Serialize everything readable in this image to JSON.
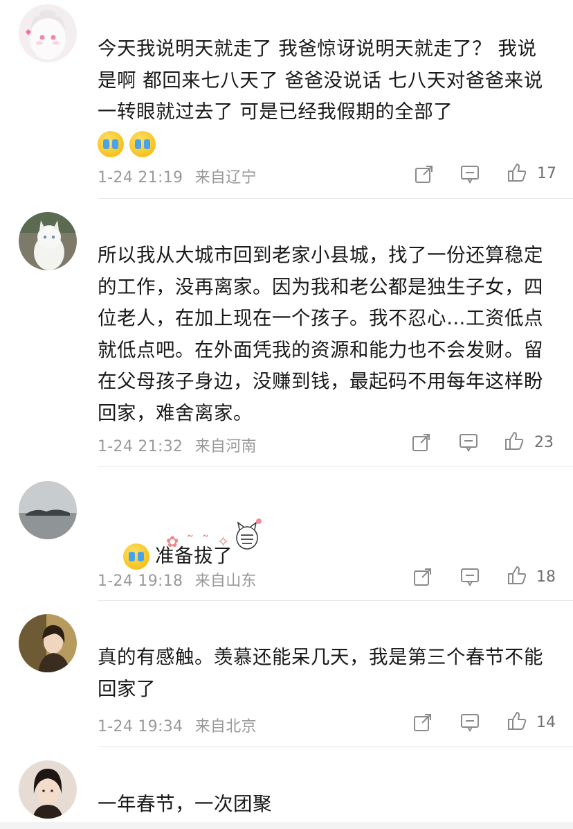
{
  "comments": [
    {
      "text": "今天我说明天就走了 我爸惊讶说明天就走了？ 我说是啊 都回来七八天了 爸爸没说话 七八天对爸爸来说一转眼就过去了 可是已经我假期的全部了",
      "emoji": [
        "crying-face-emoji",
        "crying-face-emoji"
      ],
      "date": "1-24 21:19",
      "location": "来自辽宁",
      "likes": "17",
      "avatar": "avatar-white-cat-girl"
    },
    {
      "text": "所以我从大城市回到老家小县城，找了一份还算稳定的工作，没再离家。因为我和老公都是独生子女，四位老人，在加上现在一个孩子。我不忍心…工资低点就低点吧。在外面凭我的资源和能力也不会发财。留在父母孩子身边，没赚到钱，最起码不用每年这样盼回家，难舍离家。",
      "date": "1-24 21:32",
      "location": "来自河南",
      "likes": "23",
      "avatar": "avatar-white-cat"
    },
    {
      "text": "准备拔了",
      "emoji": [
        "crying-face-emoji"
      ],
      "date": "1-24 19:18",
      "location": "来自山东",
      "likes": "18",
      "avatar": "avatar-lake-island"
    },
    {
      "text": "真的有感触。羡慕还能呆几天，我是第三个春节不能回家了",
      "date": "1-24 19:34",
      "location": "来自北京",
      "likes": "14",
      "avatar": "avatar-girl-photo"
    },
    {
      "text": "一年春节，一次团聚",
      "avatar": "avatar-girl-portrait"
    }
  ],
  "colors": {
    "meta": "#9a9a9a",
    "divider": "#e6e6e6",
    "text": "#1a1a1a"
  }
}
